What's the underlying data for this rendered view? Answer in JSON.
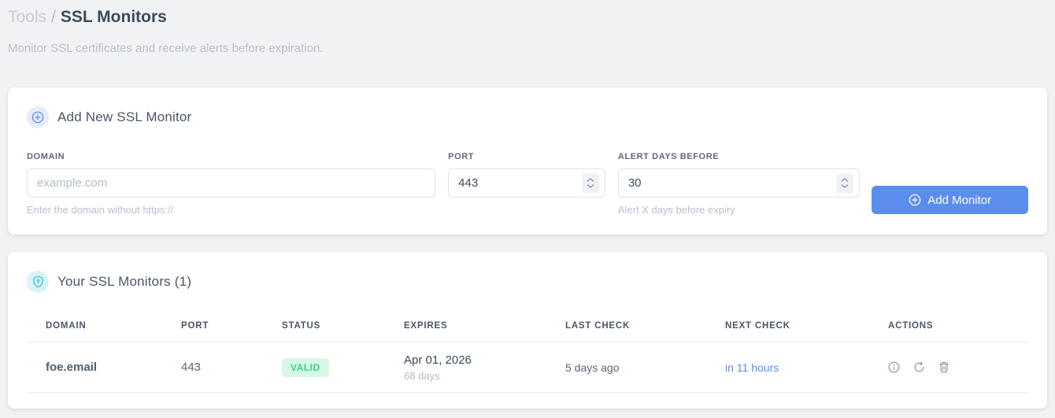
{
  "breadcrumb": {
    "section": "Tools",
    "separator": "/",
    "current": "SSL Monitors"
  },
  "subtitle": "Monitor SSL certificates and receive alerts before expiration.",
  "add_form": {
    "title": "Add New SSL Monitor",
    "fields": {
      "domain": {
        "label": "DOMAIN",
        "placeholder": "example.com",
        "helper": "Enter the domain without https://"
      },
      "port": {
        "label": "PORT",
        "value": "443"
      },
      "alert_days": {
        "label": "ALERT DAYS BEFORE",
        "value": "30",
        "helper": "Alert X days before expiry"
      }
    },
    "submit_label": "Add Monitor"
  },
  "monitors": {
    "title": "Your SSL Monitors (1)",
    "table": {
      "headers": [
        "DOMAIN",
        "PORT",
        "STATUS",
        "EXPIRES",
        "LAST CHECK",
        "NEXT CHECK",
        "ACTIONS"
      ],
      "rows": [
        {
          "domain": "foe.email",
          "port": "443",
          "status": "VALID",
          "expires_date": "Apr 01, 2026",
          "expires_days": "68 days",
          "last_check": "5 days ago",
          "next_check": "in 11 hours"
        }
      ]
    }
  },
  "icons": {
    "add_section": "plus-circle-icon",
    "monitors_section": "shield-icon",
    "row_actions": [
      "info-icon",
      "refresh-icon",
      "trash-icon"
    ]
  },
  "colors": {
    "accent_blue": "#5a8dee",
    "accent_teal": "#3ec1d3",
    "valid_badge_bg": "#d8f7e7",
    "valid_badge_text": "#35d28e",
    "page_bg": "#f1f2f4",
    "card_bg": "#ffffff"
  }
}
